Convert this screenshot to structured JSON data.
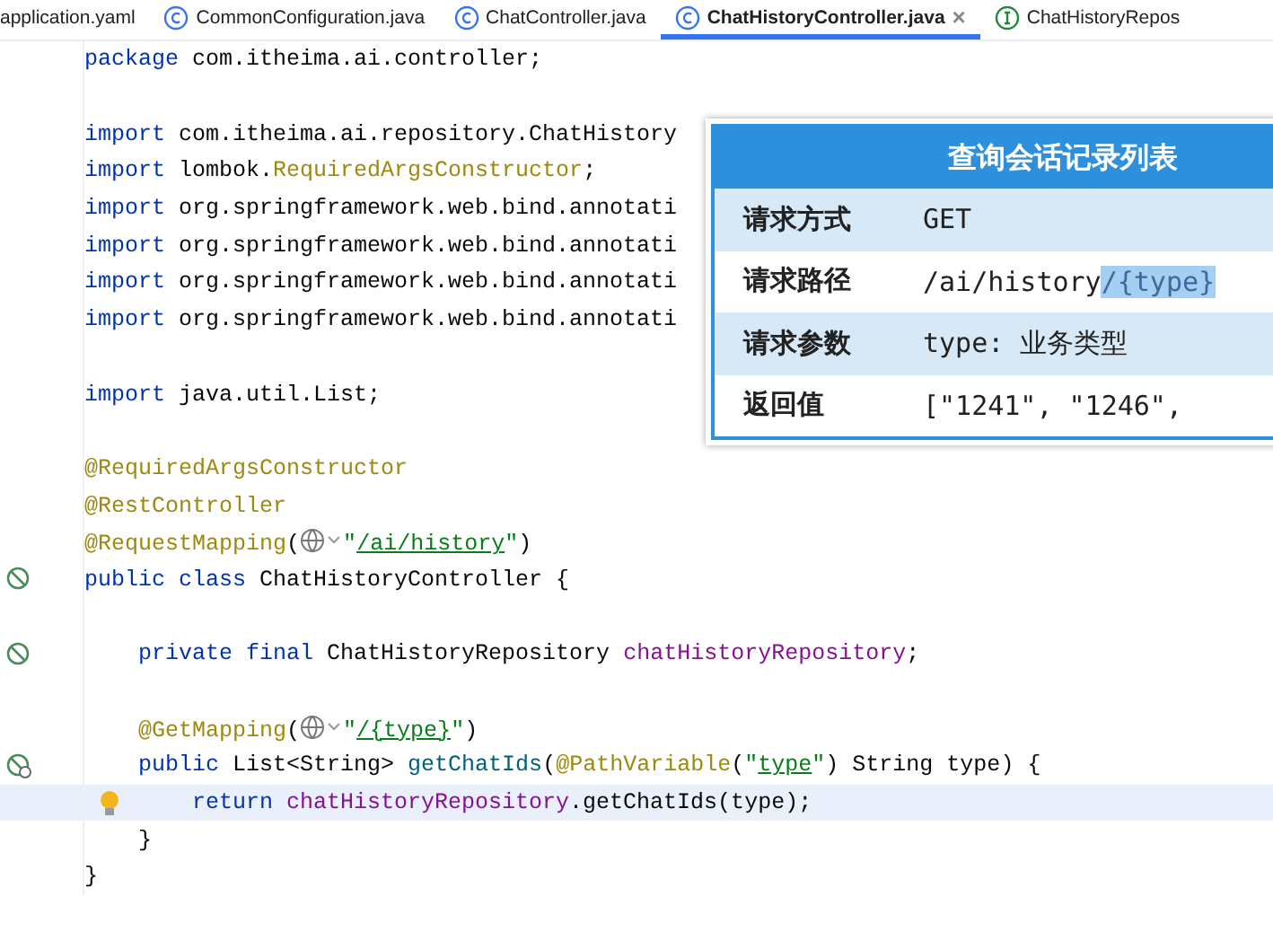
{
  "tabs": [
    {
      "label": "application.yaml",
      "kind": "file",
      "selected": false
    },
    {
      "label": "CommonConfiguration.java",
      "kind": "class",
      "selected": false
    },
    {
      "label": "ChatController.java",
      "kind": "class",
      "selected": false
    },
    {
      "label": "ChatHistoryController.java",
      "kind": "class",
      "selected": true,
      "close": "×"
    },
    {
      "label": "ChatHistoryRepos",
      "kind": "interface",
      "selected": false
    }
  ],
  "code_lines": [
    {
      "kind": "plain",
      "current": false,
      "tokens": [
        {
          "kind": "keyword",
          "text": "package"
        },
        {
          "kind": "plain",
          "text": " com.itheima.ai.controller;"
        }
      ]
    },
    {
      "kind": "blank",
      "current": false
    },
    {
      "kind": "plain",
      "current": false,
      "tokens": [
        {
          "kind": "keyword",
          "text": "import"
        },
        {
          "kind": "plain",
          "text": " com.itheima.ai.repository.ChatHistory"
        }
      ]
    },
    {
      "kind": "plain",
      "current": false,
      "tokens": [
        {
          "kind": "keyword",
          "text": "import"
        },
        {
          "kind": "plain",
          "text": " lombok."
        },
        {
          "kind": "annotation",
          "text": "RequiredArgsConstructor"
        },
        {
          "kind": "plain",
          "text": ";"
        }
      ]
    },
    {
      "kind": "plain",
      "current": false,
      "tokens": [
        {
          "kind": "keyword",
          "text": "import"
        },
        {
          "kind": "plain",
          "text": " org.springframework.web.bind.annotati"
        }
      ]
    },
    {
      "kind": "plain",
      "current": false,
      "tokens": [
        {
          "kind": "keyword",
          "text": "import"
        },
        {
          "kind": "plain",
          "text": " org.springframework.web.bind.annotati"
        }
      ]
    },
    {
      "kind": "plain",
      "current": false,
      "tokens": [
        {
          "kind": "keyword",
          "text": "import"
        },
        {
          "kind": "plain",
          "text": " org.springframework.web.bind.annotati"
        }
      ]
    },
    {
      "kind": "plain",
      "current": false,
      "tokens": [
        {
          "kind": "keyword",
          "text": "import"
        },
        {
          "kind": "plain",
          "text": " org.springframework.web.bind.annotati"
        }
      ]
    },
    {
      "kind": "blank",
      "current": false
    },
    {
      "kind": "plain",
      "current": false,
      "tokens": [
        {
          "kind": "keyword",
          "text": "import"
        },
        {
          "kind": "plain",
          "text": " java.util.List;"
        }
      ]
    },
    {
      "kind": "blank",
      "current": false
    },
    {
      "kind": "plain",
      "current": false,
      "tokens": [
        {
          "kind": "annotation",
          "text": "@RequiredArgsConstructor"
        }
      ]
    },
    {
      "kind": "plain",
      "current": false,
      "tokens": [
        {
          "kind": "annotation",
          "text": "@RestController"
        }
      ]
    },
    {
      "kind": "plain",
      "current": false,
      "tokens": [
        {
          "kind": "annotation",
          "text": "@RequestMapping"
        },
        {
          "kind": "plain",
          "text": "("
        },
        {
          "kind": "globe"
        },
        {
          "kind": "string",
          "text": "\""
        },
        {
          "kind": "url",
          "text": "/ai/history"
        },
        {
          "kind": "string",
          "text": "\""
        },
        {
          "kind": "plain",
          "text": ")"
        }
      ]
    },
    {
      "kind": "bean",
      "current": false,
      "tokens": [
        {
          "kind": "keyword",
          "text": "public class"
        },
        {
          "kind": "plain",
          "text": " ChatHistoryController {"
        }
      ]
    },
    {
      "kind": "blank",
      "current": false
    },
    {
      "kind": "bean",
      "current": false,
      "tokens": [
        {
          "kind": "keyword",
          "text": "    private final"
        },
        {
          "kind": "plain",
          "text": " ChatHistoryRepository "
        },
        {
          "kind": "field",
          "text": "chatHistoryRepository"
        },
        {
          "kind": "plain",
          "text": ";"
        }
      ]
    },
    {
      "kind": "blank",
      "current": false
    },
    {
      "kind": "plain",
      "current": false,
      "tokens": [
        {
          "kind": "annotation",
          "text": "    @GetMapping"
        },
        {
          "kind": "plain",
          "text": "("
        },
        {
          "kind": "globe"
        },
        {
          "kind": "string",
          "text": "\""
        },
        {
          "kind": "url",
          "text": "/{type}"
        },
        {
          "kind": "string",
          "text": "\""
        },
        {
          "kind": "plain",
          "text": ")"
        }
      ]
    },
    {
      "kind": "endpoint",
      "current": false,
      "tokens": [
        {
          "kind": "keyword",
          "text": "    public"
        },
        {
          "kind": "plain",
          "text": " List<String> "
        },
        {
          "kind": "method",
          "text": "getChatIds"
        },
        {
          "kind": "plain",
          "text": "("
        },
        {
          "kind": "annotation",
          "text": "@PathVariable"
        },
        {
          "kind": "plain",
          "text": "("
        },
        {
          "kind": "string",
          "text": "\""
        },
        {
          "kind": "url",
          "text": "type"
        },
        {
          "kind": "string",
          "text": "\""
        },
        {
          "kind": "plain",
          "text": ") String type) {"
        }
      ]
    },
    {
      "kind": "hint",
      "current": true,
      "tokens": [
        {
          "kind": "keyword",
          "text": "        return "
        },
        {
          "kind": "field",
          "text": "chatHistoryRepository"
        },
        {
          "kind": "plain",
          "text": ".getChatIds(type);"
        }
      ]
    },
    {
      "kind": "plain",
      "current": false,
      "tokens": [
        {
          "kind": "plain",
          "text": "    }"
        }
      ]
    },
    {
      "kind": "plain",
      "current": false,
      "tokens": [
        {
          "kind": "plain",
          "text": "}"
        }
      ]
    }
  ],
  "api_card": {
    "title": "查询会话记录列表",
    "rows": [
      {
        "label": "请求方式",
        "value": [
          {
            "text": "GET",
            "selected": false
          }
        ]
      },
      {
        "label": "请求路径",
        "value": [
          {
            "text": "/ai/history",
            "selected": false
          },
          {
            "text": "/{type}",
            "selected": true
          }
        ]
      },
      {
        "label": "请求参数",
        "value": [
          {
            "text": "type: 业务类型",
            "selected": false
          }
        ]
      },
      {
        "label": "返回值",
        "value": [
          {
            "text": "[\"1241\", \"1246\",",
            "selected": false
          }
        ]
      }
    ]
  }
}
